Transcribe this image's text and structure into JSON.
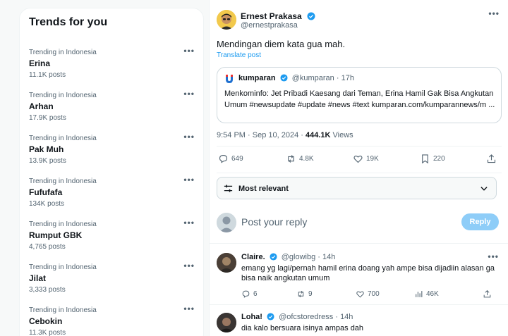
{
  "trends": {
    "title": "Trends for you",
    "items": [
      {
        "category": "Trending in Indonesia",
        "name": "Erina",
        "count": "11.1K posts"
      },
      {
        "category": "Trending in Indonesia",
        "name": "Arhan",
        "count": "17.9K posts"
      },
      {
        "category": "Trending in Indonesia",
        "name": "Pak Muh",
        "count": "13.9K posts"
      },
      {
        "category": "Trending in Indonesia",
        "name": "Fufufafa",
        "count": "134K posts"
      },
      {
        "category": "Trending in Indonesia",
        "name": "Rumput GBK",
        "count": "4,765 posts"
      },
      {
        "category": "Trending in Indonesia",
        "name": "Jilat",
        "count": "3,333 posts"
      },
      {
        "category": "Trending in Indonesia",
        "name": "Cebokin",
        "count": "11.3K posts"
      }
    ],
    "more_icon": "•••"
  },
  "post": {
    "author_name": "Ernest Prakasa",
    "author_handle": "@ernestprakasa",
    "more_icon": "•••",
    "text": "Mendingan diem kata gua mah.",
    "translate": "Translate post",
    "quote": {
      "name": "kumparan",
      "handle": "@kumparan",
      "time": "· 17h",
      "logo": "U",
      "text": "Menkominfo: Jet Pribadi Kaesang dari Teman, Erina Hamil Gak Bisa Angkutan Umum #newsupdate #update #news #text kumparan.com/kumparannews/m ..."
    },
    "time": "9:54 PM · Sep 10, 2024 · ",
    "views_count": "444.1K",
    "views_label": " Views",
    "stats": {
      "replies": "649",
      "reposts": "4.8K",
      "likes": "19K",
      "bookmarks": "220"
    }
  },
  "sort": {
    "label": "Most relevant"
  },
  "reply_box": {
    "placeholder": "Post your reply",
    "button": "Reply"
  },
  "replies": [
    {
      "name": "Claire.",
      "handle": "@glowibg",
      "time": "· 14h",
      "text": "emang yg lagi/pernah hamil erina doang yah ampe bisa dijadiin alasan ga bisa naik angkutan umum",
      "replies": "6",
      "reposts": "9",
      "likes": "700",
      "views": "46K"
    },
    {
      "name": "Loha!",
      "handle": "@ofcstoredress",
      "time": "· 14h",
      "text": "dia kalo bersuara isinya ampas dah"
    }
  ],
  "colors": {
    "accent": "#1d9bf0",
    "reply_button": "#8ecdf8",
    "text": "#0f1419",
    "muted": "#536471"
  }
}
